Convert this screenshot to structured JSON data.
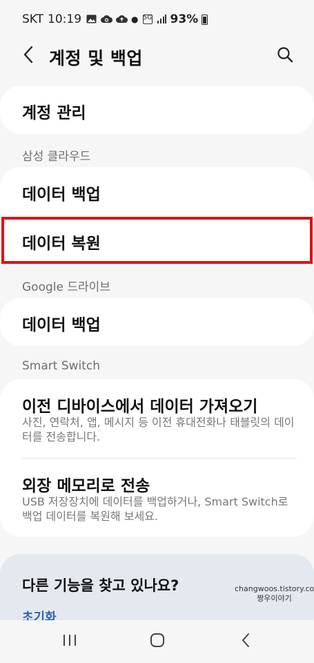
{
  "status_bar": {
    "carrier": "SKT",
    "time": "10:19",
    "icons": [
      "gallery-icon",
      "cloud-sync-icon",
      "cloud-upload-icon",
      "dot-icon",
      "5g-icon",
      "signal-icon"
    ],
    "battery": "93%"
  },
  "header": {
    "title": "계정 및 백업",
    "back_icon": "chevron-left-icon",
    "search_icon": "search-icon"
  },
  "account": {
    "label": "계정 관리"
  },
  "samsung_cloud": {
    "section_label": "삼성 클라우드",
    "items": [
      {
        "label": "데이터 백업"
      },
      {
        "label": "데이터 복원"
      }
    ]
  },
  "google_drive": {
    "section_label": "Google 드라이브",
    "items": [
      {
        "label": "데이터 백업"
      }
    ]
  },
  "smart_switch": {
    "section_label": "Smart Switch",
    "items": [
      {
        "label": "이전 디바이스에서 데이터 가져오기",
        "description": "사진, 연락처, 앱, 메시지 등 이전 휴대전화나 태블릿의 데이터를 전송합니다."
      },
      {
        "label": "외장 메모리로 전송",
        "description": "USB 저장장치에 데이터를 백업하거나, Smart Switch로 백업 데이터를 복원해 보세요."
      }
    ]
  },
  "promo": {
    "title": "다른 기능을 찾고 있나요?",
    "link": "초기화"
  },
  "watermark": {
    "line1": "changwoos.tistory.com",
    "line2": "짱우이야기"
  },
  "nav_bar": {
    "icons": [
      "recents-icon",
      "home-icon",
      "back-icon"
    ]
  },
  "colors": {
    "background": "#f6f6f6",
    "card": "#ffffff",
    "highlight_border": "#e01010",
    "link": "#2e62b0",
    "promo_bg": "#e3e9ef"
  }
}
